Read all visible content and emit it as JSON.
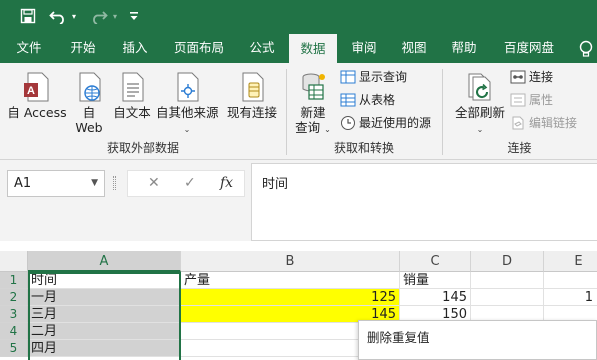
{
  "colors": {
    "brand": "#217346",
    "highlight": "#ffff00"
  },
  "quick_access": {
    "icons": [
      "save-icon",
      "undo-icon",
      "redo-icon",
      "customize-icon"
    ]
  },
  "tabs": [
    "文件",
    "开始",
    "插入",
    "页面布局",
    "公式",
    "数据",
    "审阅",
    "视图",
    "帮助",
    "百度网盘"
  ],
  "active_tab": "数据",
  "ribbon": {
    "get_external": {
      "access": "自 Access",
      "web_line1": "自",
      "web_line2": "Web",
      "text": "自文本",
      "other": "自其他来源",
      "existing": "现有连接",
      "group_label": "获取外部数据"
    },
    "get_transform": {
      "new_query_line1": "新建",
      "new_query_line2": "查询",
      "show_queries": "显示查询",
      "from_table": "从表格",
      "recent_sources": "最近使用的源",
      "group_label": "获取和转换"
    },
    "connections": {
      "refresh_all": "全部刷新",
      "connections": "连接",
      "properties": "属性",
      "edit_links": "编辑链接",
      "group_label": "连接"
    }
  },
  "formula_bar": {
    "name_box": "A1",
    "cancel": "✕",
    "enter": "✓",
    "fx": "fx",
    "content": "时间"
  },
  "grid": {
    "columns": [
      "A",
      "B",
      "C",
      "D",
      "E"
    ],
    "rows": [
      "1",
      "2",
      "3",
      "4",
      "5"
    ],
    "cells": {
      "A1": "时间",
      "B1": "产量",
      "C1": "销量",
      "A2": "一月",
      "B2": "125",
      "C2": "145",
      "E2": "1",
      "A3": "三月",
      "B3": "145",
      "C3": "150",
      "A4": "二月",
      "A5": "四月"
    }
  },
  "context_menu": {
    "item": "删除重复值"
  }
}
